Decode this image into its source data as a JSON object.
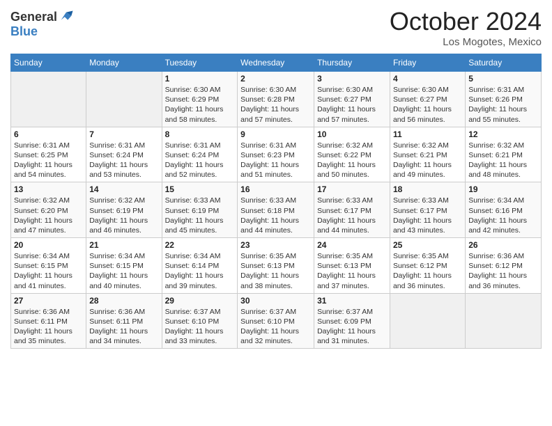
{
  "logo": {
    "general": "General",
    "blue": "Blue"
  },
  "title": "October 2024",
  "location": "Los Mogotes, Mexico",
  "weekdays": [
    "Sunday",
    "Monday",
    "Tuesday",
    "Wednesday",
    "Thursday",
    "Friday",
    "Saturday"
  ],
  "weeks": [
    [
      {
        "day": "",
        "info": ""
      },
      {
        "day": "",
        "info": ""
      },
      {
        "day": "1",
        "info": "Sunrise: 6:30 AM\nSunset: 6:29 PM\nDaylight: 11 hours and 58 minutes."
      },
      {
        "day": "2",
        "info": "Sunrise: 6:30 AM\nSunset: 6:28 PM\nDaylight: 11 hours and 57 minutes."
      },
      {
        "day": "3",
        "info": "Sunrise: 6:30 AM\nSunset: 6:27 PM\nDaylight: 11 hours and 57 minutes."
      },
      {
        "day": "4",
        "info": "Sunrise: 6:30 AM\nSunset: 6:27 PM\nDaylight: 11 hours and 56 minutes."
      },
      {
        "day": "5",
        "info": "Sunrise: 6:31 AM\nSunset: 6:26 PM\nDaylight: 11 hours and 55 minutes."
      }
    ],
    [
      {
        "day": "6",
        "info": "Sunrise: 6:31 AM\nSunset: 6:25 PM\nDaylight: 11 hours and 54 minutes."
      },
      {
        "day": "7",
        "info": "Sunrise: 6:31 AM\nSunset: 6:24 PM\nDaylight: 11 hours and 53 minutes."
      },
      {
        "day": "8",
        "info": "Sunrise: 6:31 AM\nSunset: 6:24 PM\nDaylight: 11 hours and 52 minutes."
      },
      {
        "day": "9",
        "info": "Sunrise: 6:31 AM\nSunset: 6:23 PM\nDaylight: 11 hours and 51 minutes."
      },
      {
        "day": "10",
        "info": "Sunrise: 6:32 AM\nSunset: 6:22 PM\nDaylight: 11 hours and 50 minutes."
      },
      {
        "day": "11",
        "info": "Sunrise: 6:32 AM\nSunset: 6:21 PM\nDaylight: 11 hours and 49 minutes."
      },
      {
        "day": "12",
        "info": "Sunrise: 6:32 AM\nSunset: 6:21 PM\nDaylight: 11 hours and 48 minutes."
      }
    ],
    [
      {
        "day": "13",
        "info": "Sunrise: 6:32 AM\nSunset: 6:20 PM\nDaylight: 11 hours and 47 minutes."
      },
      {
        "day": "14",
        "info": "Sunrise: 6:32 AM\nSunset: 6:19 PM\nDaylight: 11 hours and 46 minutes."
      },
      {
        "day": "15",
        "info": "Sunrise: 6:33 AM\nSunset: 6:19 PM\nDaylight: 11 hours and 45 minutes."
      },
      {
        "day": "16",
        "info": "Sunrise: 6:33 AM\nSunset: 6:18 PM\nDaylight: 11 hours and 44 minutes."
      },
      {
        "day": "17",
        "info": "Sunrise: 6:33 AM\nSunset: 6:17 PM\nDaylight: 11 hours and 44 minutes."
      },
      {
        "day": "18",
        "info": "Sunrise: 6:33 AM\nSunset: 6:17 PM\nDaylight: 11 hours and 43 minutes."
      },
      {
        "day": "19",
        "info": "Sunrise: 6:34 AM\nSunset: 6:16 PM\nDaylight: 11 hours and 42 minutes."
      }
    ],
    [
      {
        "day": "20",
        "info": "Sunrise: 6:34 AM\nSunset: 6:15 PM\nDaylight: 11 hours and 41 minutes."
      },
      {
        "day": "21",
        "info": "Sunrise: 6:34 AM\nSunset: 6:15 PM\nDaylight: 11 hours and 40 minutes."
      },
      {
        "day": "22",
        "info": "Sunrise: 6:34 AM\nSunset: 6:14 PM\nDaylight: 11 hours and 39 minutes."
      },
      {
        "day": "23",
        "info": "Sunrise: 6:35 AM\nSunset: 6:13 PM\nDaylight: 11 hours and 38 minutes."
      },
      {
        "day": "24",
        "info": "Sunrise: 6:35 AM\nSunset: 6:13 PM\nDaylight: 11 hours and 37 minutes."
      },
      {
        "day": "25",
        "info": "Sunrise: 6:35 AM\nSunset: 6:12 PM\nDaylight: 11 hours and 36 minutes."
      },
      {
        "day": "26",
        "info": "Sunrise: 6:36 AM\nSunset: 6:12 PM\nDaylight: 11 hours and 36 minutes."
      }
    ],
    [
      {
        "day": "27",
        "info": "Sunrise: 6:36 AM\nSunset: 6:11 PM\nDaylight: 11 hours and 35 minutes."
      },
      {
        "day": "28",
        "info": "Sunrise: 6:36 AM\nSunset: 6:11 PM\nDaylight: 11 hours and 34 minutes."
      },
      {
        "day": "29",
        "info": "Sunrise: 6:37 AM\nSunset: 6:10 PM\nDaylight: 11 hours and 33 minutes."
      },
      {
        "day": "30",
        "info": "Sunrise: 6:37 AM\nSunset: 6:10 PM\nDaylight: 11 hours and 32 minutes."
      },
      {
        "day": "31",
        "info": "Sunrise: 6:37 AM\nSunset: 6:09 PM\nDaylight: 11 hours and 31 minutes."
      },
      {
        "day": "",
        "info": ""
      },
      {
        "day": "",
        "info": ""
      }
    ]
  ]
}
